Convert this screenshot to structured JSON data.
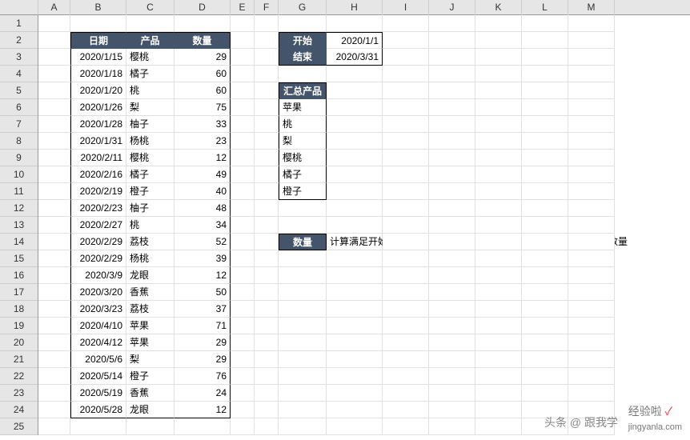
{
  "columns": [
    "A",
    "B",
    "C",
    "D",
    "E",
    "F",
    "G",
    "H",
    "I",
    "J",
    "K",
    "L",
    "M"
  ],
  "rowCount": 25,
  "table": {
    "headers": {
      "date": "日期",
      "product": "产品",
      "qty": "数量"
    },
    "rows": [
      {
        "date": "2020/1/15",
        "product": "樱桃",
        "qty": 29
      },
      {
        "date": "2020/1/18",
        "product": "橘子",
        "qty": 60
      },
      {
        "date": "2020/1/20",
        "product": "桃",
        "qty": 60
      },
      {
        "date": "2020/1/26",
        "product": "梨",
        "qty": 75
      },
      {
        "date": "2020/1/28",
        "product": "柚子",
        "qty": 33
      },
      {
        "date": "2020/1/31",
        "product": "杨桃",
        "qty": 23
      },
      {
        "date": "2020/2/11",
        "product": "樱桃",
        "qty": 12
      },
      {
        "date": "2020/2/16",
        "product": "橘子",
        "qty": 49
      },
      {
        "date": "2020/2/19",
        "product": "橙子",
        "qty": 40
      },
      {
        "date": "2020/2/23",
        "product": "柚子",
        "qty": 48
      },
      {
        "date": "2020/2/27",
        "product": "桃",
        "qty": 34
      },
      {
        "date": "2020/2/29",
        "product": "荔枝",
        "qty": 52
      },
      {
        "date": "2020/2/29",
        "product": "杨桃",
        "qty": 39
      },
      {
        "date": "2020/3/9",
        "product": "龙眼",
        "qty": 12
      },
      {
        "date": "2020/3/20",
        "product": "香蕉",
        "qty": 50
      },
      {
        "date": "2020/3/23",
        "product": "荔枝",
        "qty": 37
      },
      {
        "date": "2020/4/10",
        "product": "苹果",
        "qty": 71
      },
      {
        "date": "2020/4/12",
        "product": "苹果",
        "qty": 29
      },
      {
        "date": "2020/5/6",
        "product": "梨",
        "qty": 29
      },
      {
        "date": "2020/5/14",
        "product": "橙子",
        "qty": 76
      },
      {
        "date": "2020/5/19",
        "product": "香蕉",
        "qty": 24
      },
      {
        "date": "2020/5/28",
        "product": "龙眼",
        "qty": 12
      }
    ]
  },
  "range": {
    "start_label": "开始",
    "start_value": "2020/1/1",
    "end_label": "结束",
    "end_value": "2020/3/31"
  },
  "summary": {
    "header": "汇总产品",
    "items": [
      "苹果",
      "桃",
      "梨",
      "樱桃",
      "橘子",
      "橙子"
    ]
  },
  "calc": {
    "label": "数量",
    "desc": "计算满足开始日期和结束日期的时间区间内，上面需要汇总的产品数量"
  },
  "watermark": {
    "a": "头条 @ 跟我学",
    "b": "经验啦",
    "c": "jingyanla.com"
  }
}
